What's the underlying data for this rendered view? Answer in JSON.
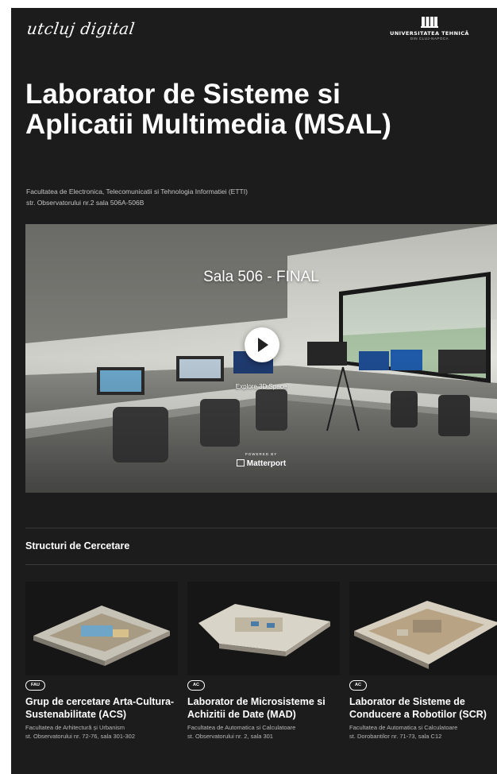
{
  "header": {
    "brand": "utcluj digital",
    "university": {
      "name": "UNIVERSITATEA TEHNICĂ",
      "city": "DIN CLUJ-NAPOCA"
    }
  },
  "lab": {
    "title": "Laborator de Sisteme si Aplicatii Multimedia (MSAL)",
    "faculty": "Facultatea de Electronica, Telecomunicatii si Tehnologia Informatiei (ETTI)",
    "address": "str. Observatorului nr.2 sala 506A-506B"
  },
  "viewer": {
    "space_title": "Sala 506 - FINAL",
    "explore_label": "Explore 3D Space",
    "powered_by": "POWERED BY",
    "provider": "Matterport",
    "play_icon": "play-icon"
  },
  "section": {
    "title": "Structuri de Cercetare"
  },
  "cards": [
    {
      "badge": "FAU",
      "title": "Grup de cercetare Arta-Cultura-Sustenabilitate (ACS)",
      "faculty": "Facultatea de Arhitectură și Urbanism",
      "address": "st. Observatorului nr. 72-76, sala 301-302"
    },
    {
      "badge": "AC",
      "title": "Laborator de Microsisteme si Achizitii de Date (MAD)",
      "faculty": "Facultatea de Automatica si Calculatoare",
      "address": "st. Observatorului nr. 2, sala 301"
    },
    {
      "badge": "AC",
      "title": "Laborator de Sisteme de Conducere a Robotilor (SCR)",
      "faculty": "Facultatea de Automatica si Calculatoare",
      "address": "st. Dorobantilor nr. 71-73, sala C12"
    }
  ]
}
